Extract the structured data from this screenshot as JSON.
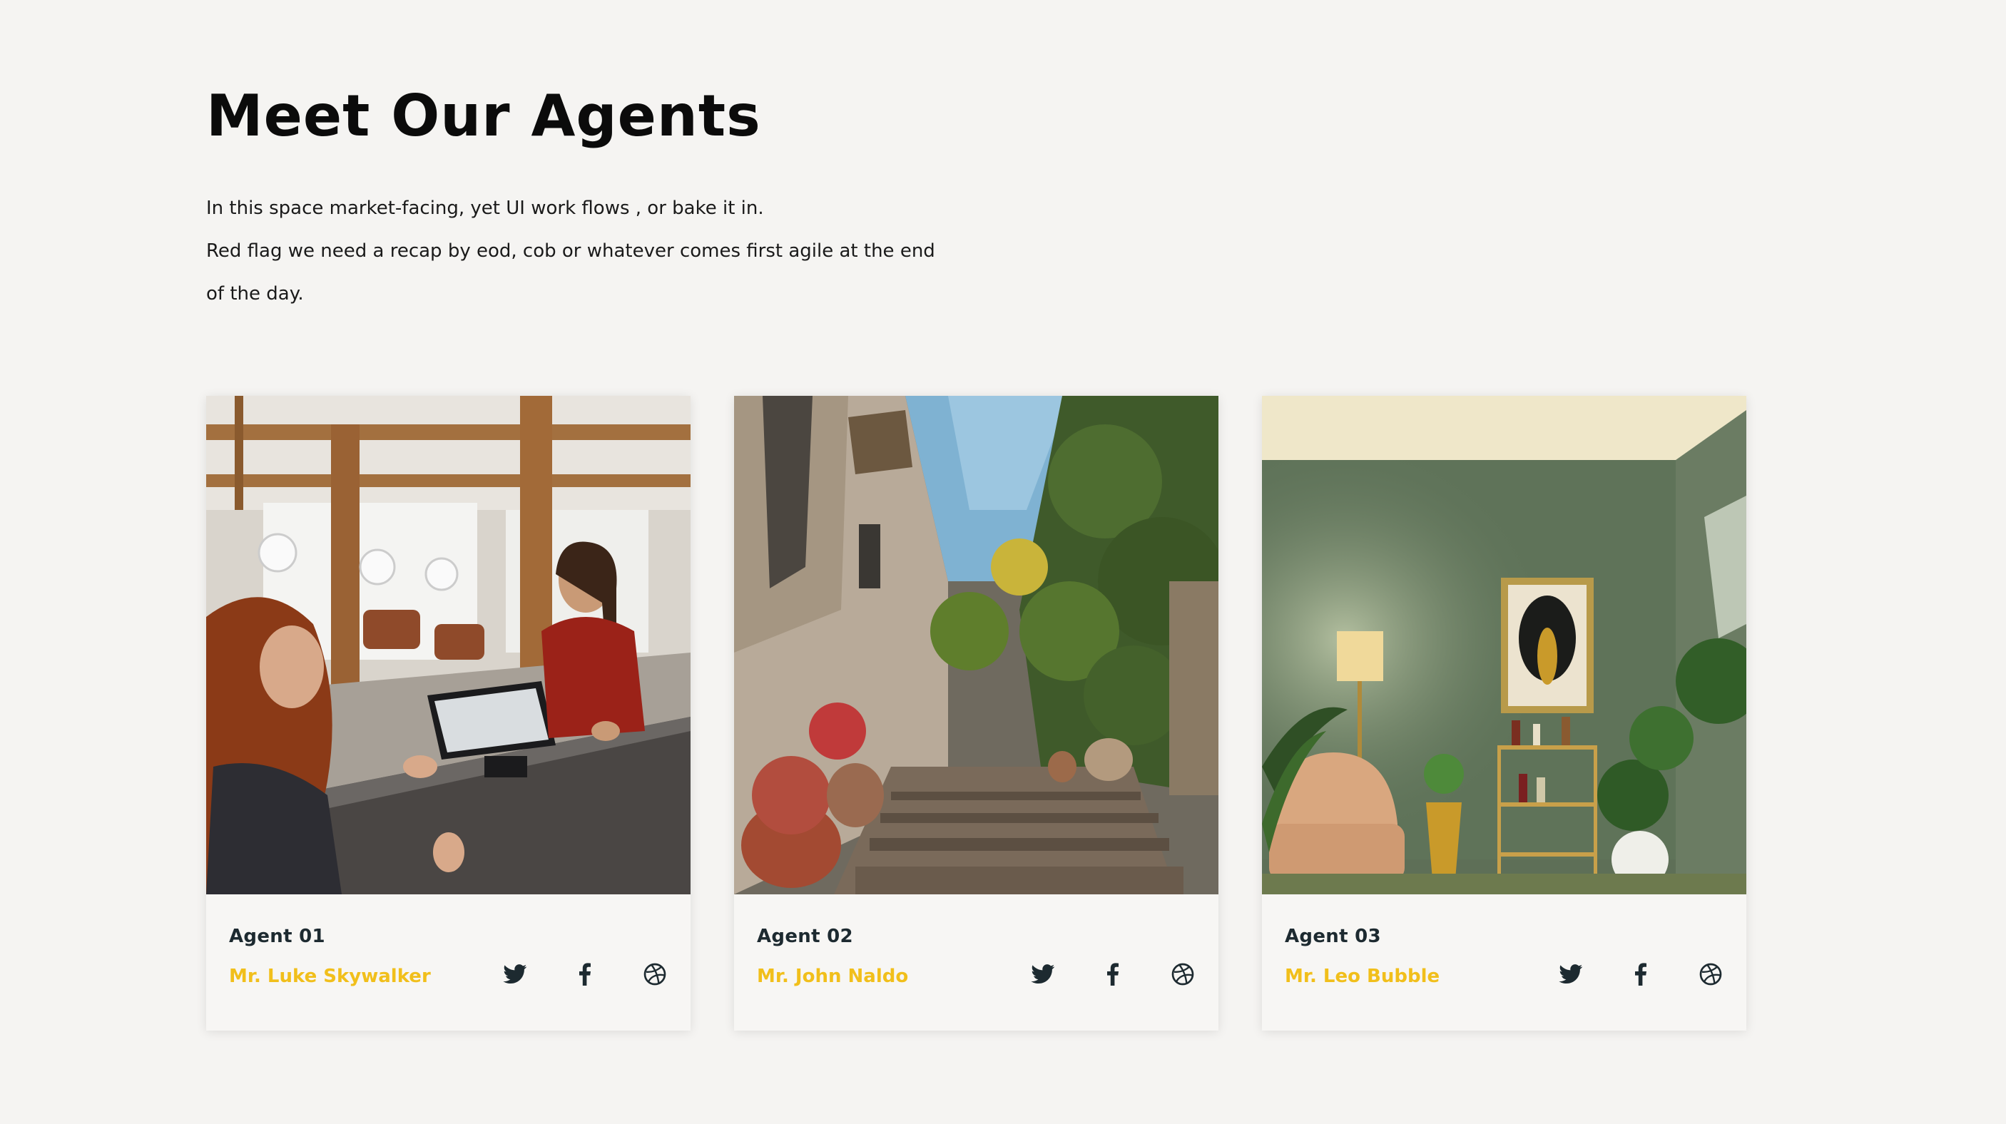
{
  "section": {
    "title": "Meet Our Agents",
    "description_lines": [
      "In this space market-facing, yet UI work flows , or bake it in.",
      "Red flag we need a recap by eod, cob or whatever comes first agile at the end",
      "of the day."
    ]
  },
  "agents": [
    {
      "label": "Agent 01",
      "name": "Mr. Luke Skywalker",
      "photo": "salon-checkout-photo"
    },
    {
      "label": "Agent 02",
      "name": "Mr. John Naldo",
      "photo": "stone-alley-stairs-photo"
    },
    {
      "label": "Agent 03",
      "name": "Mr. Leo Bubble",
      "photo": "green-living-room-photo"
    }
  ],
  "social_icons": [
    "twitter-icon",
    "facebook-icon",
    "dribbble-icon"
  ],
  "colors": {
    "background": "#f5f4f2",
    "accent": "#f1bf1b",
    "label": "#1d2a30",
    "icon": "#1d2a30"
  }
}
